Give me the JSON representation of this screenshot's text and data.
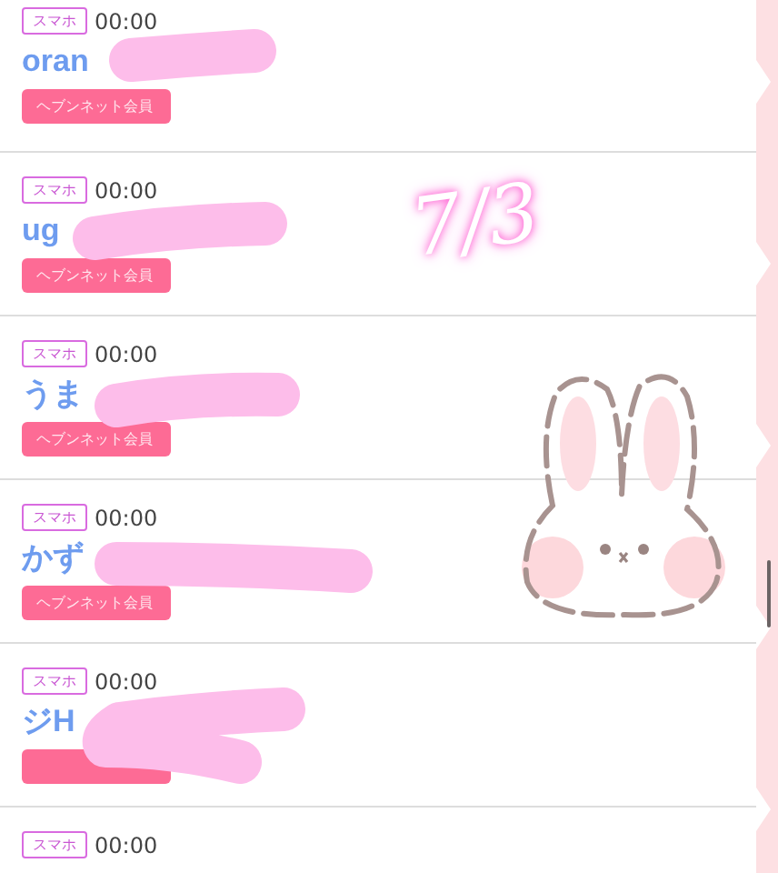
{
  "rows": [
    {
      "device": "スマホ",
      "time": "00:00",
      "name": "oran",
      "badge": "ヘブンネット会員"
    },
    {
      "device": "スマホ",
      "time": "00:00",
      "name": "ug",
      "badge": "ヘブンネット会員"
    },
    {
      "device": "スマホ",
      "time": "00:00",
      "name": "うま",
      "badge": "ヘブンネット会員"
    },
    {
      "device": "スマホ",
      "time": "00:00",
      "name": "かず",
      "badge": "ヘブンネット会員"
    },
    {
      "device": "スマホ",
      "time": "00:00",
      "name": "ジH",
      "badge": ""
    },
    {
      "device": "スマホ",
      "time": "00:00"
    }
  ],
  "annotation": {
    "text": "7/3"
  }
}
